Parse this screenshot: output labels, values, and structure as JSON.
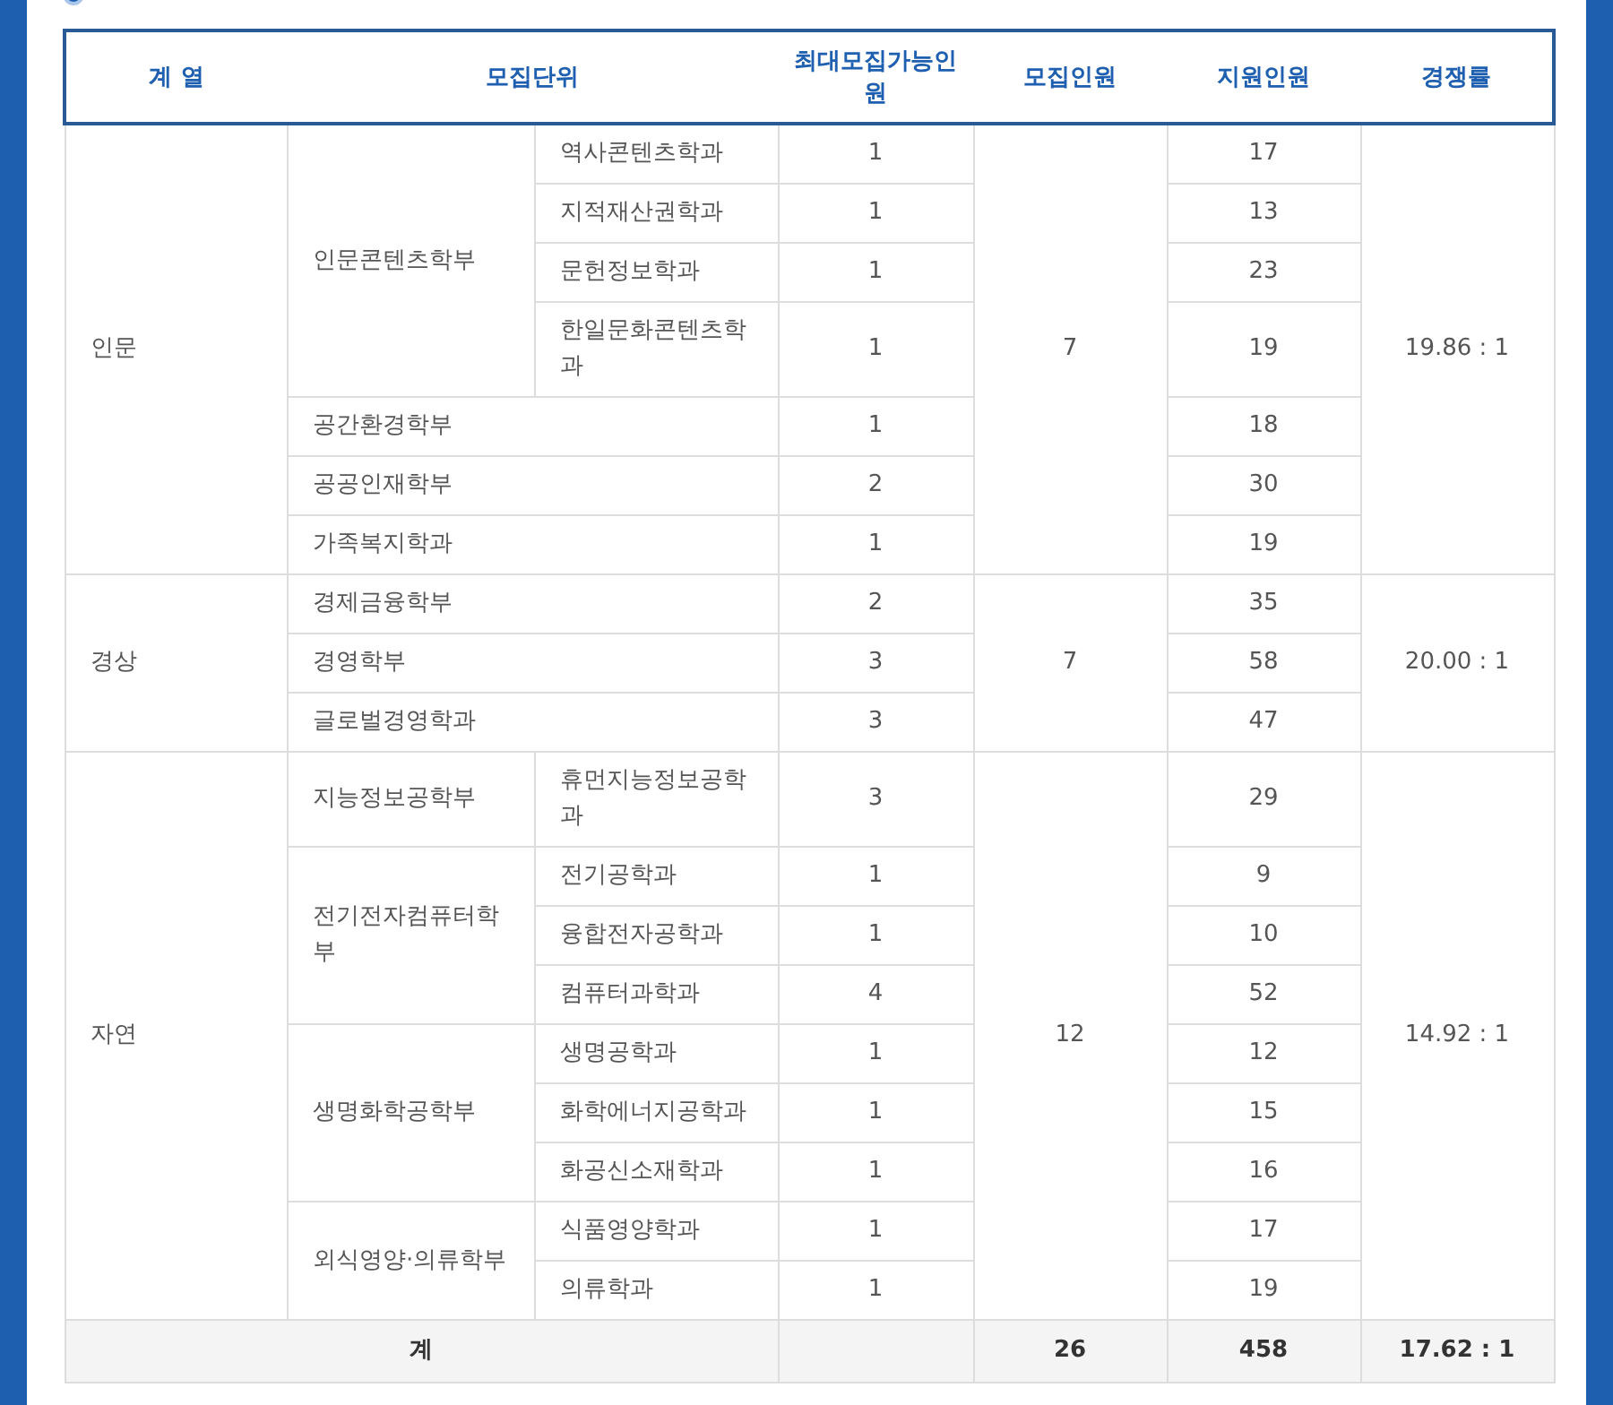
{
  "table": {
    "columns": [
      "계 열",
      "모집단위",
      "최대모집가능인원",
      "모집인원",
      "지원인원",
      "경쟁률"
    ],
    "groups": [
      {
        "field": "인문",
        "recruit": "7",
        "ratio": "19.86 : 1",
        "units": [
          {
            "kind": "department",
            "name": "인문콘텐츠학부",
            "majors": [
              {
                "name": "역사콘텐츠학과",
                "max": "1",
                "applicants": "17"
              },
              {
                "name": "지적재산권학과",
                "max": "1",
                "applicants": "13"
              },
              {
                "name": "문헌정보학과",
                "max": "1",
                "applicants": "23"
              },
              {
                "name": "한일문화콘텐츠학과",
                "max": "1",
                "applicants": "19"
              }
            ]
          },
          {
            "kind": "single",
            "name": "공간환경학부",
            "max": "1",
            "applicants": "18"
          },
          {
            "kind": "single",
            "name": "공공인재학부",
            "max": "2",
            "applicants": "30"
          },
          {
            "kind": "single",
            "name": "가족복지학과",
            "max": "1",
            "applicants": "19"
          }
        ]
      },
      {
        "field": "경상",
        "recruit": "7",
        "ratio": "20.00 : 1",
        "units": [
          {
            "kind": "single",
            "name": "경제금융학부",
            "max": "2",
            "applicants": "35"
          },
          {
            "kind": "single",
            "name": "경영학부",
            "max": "3",
            "applicants": "58"
          },
          {
            "kind": "single",
            "name": "글로벌경영학과",
            "max": "3",
            "applicants": "47"
          }
        ]
      },
      {
        "field": "자연",
        "recruit": "12",
        "ratio": "14.92 : 1",
        "units": [
          {
            "kind": "department",
            "name": "지능정보공학부",
            "majors": [
              {
                "name": "휴먼지능정보공학과",
                "max": "3",
                "applicants": "29"
              }
            ]
          },
          {
            "kind": "department",
            "name": "전기전자컴퓨터학부",
            "majors": [
              {
                "name": "전기공학과",
                "max": "1",
                "applicants": "9"
              },
              {
                "name": "융합전자공학과",
                "max": "1",
                "applicants": "10"
              },
              {
                "name": "컴퓨터과학과",
                "max": "4",
                "applicants": "52"
              }
            ]
          },
          {
            "kind": "department",
            "name": "생명화학공학부",
            "majors": [
              {
                "name": "생명공학과",
                "max": "1",
                "applicants": "12"
              },
              {
                "name": "화학에너지공학과",
                "max": "1",
                "applicants": "15"
              },
              {
                "name": "화공신소재학과",
                "max": "1",
                "applicants": "16"
              }
            ]
          },
          {
            "kind": "department",
            "name": "외식영양·의류학부",
            "majors": [
              {
                "name": "식품영양학과",
                "max": "1",
                "applicants": "17"
              },
              {
                "name": "의류학과",
                "max": "1",
                "applicants": "19"
              }
            ]
          }
        ]
      }
    ],
    "total": {
      "label": "계",
      "recruit": "26",
      "applicants": "458",
      "ratio": "17.62 : 1"
    }
  }
}
